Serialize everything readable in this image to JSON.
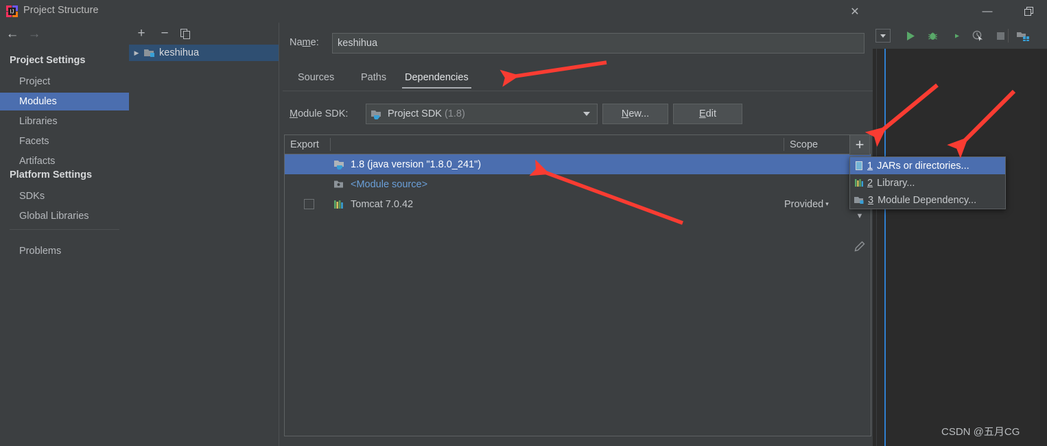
{
  "dialog": {
    "title": "Project Structure",
    "close_label": "✕",
    "icon": "intellij-logo-icon"
  },
  "nav": {
    "back": "←",
    "forward": "→"
  },
  "sidebar": {
    "groups": [
      {
        "label": "Project Settings"
      },
      {
        "label": "Platform Settings"
      }
    ],
    "items": [
      {
        "label": "Project",
        "selected": false
      },
      {
        "label": "Modules",
        "selected": true
      },
      {
        "label": "Libraries",
        "selected": false
      },
      {
        "label": "Facets",
        "selected": false
      },
      {
        "label": "Artifacts",
        "selected": false
      },
      {
        "label": "SDKs",
        "selected": false
      },
      {
        "label": "Global Libraries",
        "selected": false
      },
      {
        "label": "Problems",
        "selected": false
      }
    ]
  },
  "tree": {
    "toolbar": {
      "add": "+",
      "remove": "−",
      "copy": "copy-icon"
    },
    "nodes": [
      {
        "label": "keshihua",
        "caret": "▶",
        "selected": true
      }
    ]
  },
  "detail": {
    "name_label": "Na",
    "name_label_mnemonic": "m",
    "name_label_rest": "e:",
    "name_value": "keshihua",
    "tabs": [
      {
        "label": "Sources",
        "active": false
      },
      {
        "label": "Paths",
        "active": false
      },
      {
        "label": "Dependencies",
        "active": true
      }
    ],
    "sdk": {
      "label_pre": "",
      "label_mnemonic": "M",
      "label_rest": "odule SDK:",
      "value": "Project SDK",
      "value_dim": "(1.8)",
      "new_button_pre": "",
      "new_button_mnemonic": "N",
      "new_button_rest": "ew...",
      "edit_button_pre": "",
      "edit_button_mnemonic": "E",
      "edit_button_rest": "dit"
    },
    "table": {
      "columns": [
        {
          "label": "Export"
        },
        {
          "label": ""
        },
        {
          "label": "Scope"
        }
      ],
      "rows": [
        {
          "checkbox": false,
          "has_checkbox": false,
          "icon": "jdk-folder-icon",
          "label": "1.8 (java version \"1.8.0_241\")",
          "scope": "",
          "selected": true,
          "label_color": "#ffffff"
        },
        {
          "checkbox": false,
          "has_checkbox": false,
          "icon": "module-source-icon",
          "label": "<Module source>",
          "scope": "",
          "selected": false,
          "label_color": "#6a9fd8"
        },
        {
          "checkbox": false,
          "has_checkbox": true,
          "icon": "library-icon",
          "label": "Tomcat 7.0.42",
          "scope": "Provided",
          "scope_caret": "▾",
          "selected": false,
          "label_color": "#c4c7ca"
        }
      ]
    },
    "side_buttons": [
      {
        "name": "add-dependency-button",
        "glyph": "+"
      },
      {
        "name": "move-down-button",
        "glyph": "▼"
      },
      {
        "name": "edit-button",
        "glyph": "pencil-icon"
      }
    ]
  },
  "popup_menu": {
    "items": [
      {
        "num": "1",
        "label": "JARs or directories...",
        "icon": "jar-icon",
        "selected": true
      },
      {
        "num": "2",
        "label": "Library...",
        "icon": "library-icon",
        "selected": false
      },
      {
        "num": "3",
        "label": "Module Dependency...",
        "icon": "module-icon",
        "selected": false
      }
    ]
  },
  "ide": {
    "window_buttons": [
      {
        "name": "minimize-button",
        "glyph": "—"
      },
      {
        "name": "restore-button",
        "glyph": "❐"
      }
    ],
    "toolbar_icons": [
      {
        "name": "run-config-dropdown",
        "glyph": "▾"
      },
      {
        "name": "run-icon",
        "glyph": "▶"
      },
      {
        "name": "debug-icon",
        "glyph": "bug"
      },
      {
        "name": "run-coverage-icon",
        "glyph": "coverage"
      },
      {
        "name": "profile-icon",
        "glyph": "profile"
      },
      {
        "name": "stop-icon",
        "glyph": "■"
      },
      {
        "name": "project-structure-icon",
        "glyph": "module"
      }
    ]
  },
  "watermark": {
    "text": "CSDN @五月CG"
  },
  "colors": {
    "accent_blue": "#4b6eaf",
    "panel_bg": "#3c3f41",
    "ide_bg": "#2b2b2b",
    "arrow_red": "#fa3c32",
    "link_blue": "#6a9fd8"
  }
}
